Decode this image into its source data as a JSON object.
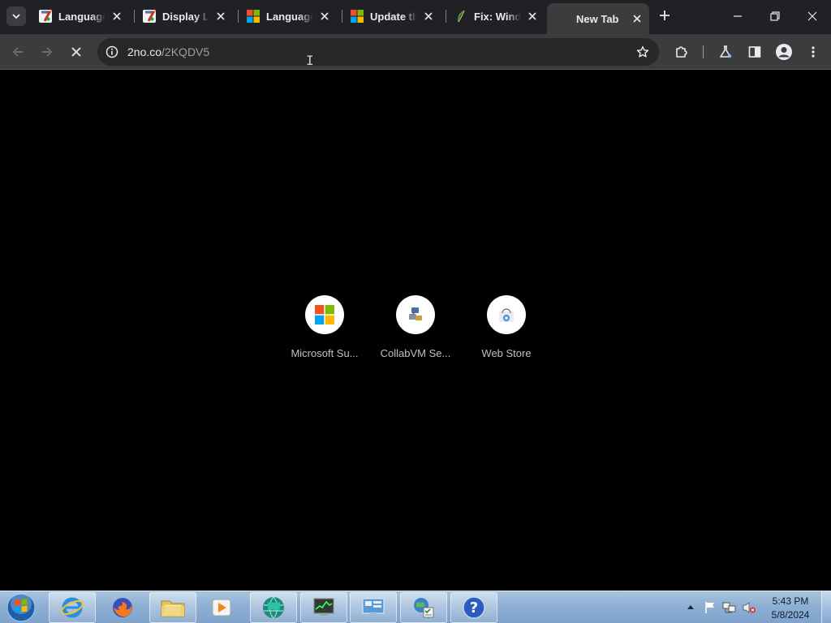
{
  "browser": {
    "tabs": [
      {
        "title": "Language",
        "icon": "seven-forums-icon"
      },
      {
        "title": "Display La",
        "icon": "seven-forums-icon"
      },
      {
        "title": "Language",
        "icon": "microsoft-logo-icon"
      },
      {
        "title": "Update th",
        "icon": "microsoft-logo-icon"
      },
      {
        "title": "Fix: Windo",
        "icon": "feather-icon"
      },
      {
        "title": "New Tab",
        "icon": "none",
        "active": true
      }
    ],
    "address": {
      "host": "2no.co",
      "path": "/2KQDV5"
    }
  },
  "shortcuts": [
    {
      "label": "Microsoft Su...",
      "icon": "microsoft-logo-icon"
    },
    {
      "label": "CollabVM Se...",
      "icon": "collabvm-icon"
    },
    {
      "label": "Web Store",
      "icon": "web-store-icon"
    }
  ],
  "taskbar": {
    "apps": [
      "internet-explorer",
      "firefox",
      "windows-explorer",
      "media-player",
      "browser-globe",
      "task-manager",
      "control-panel",
      "network-globe",
      "help-and-support"
    ],
    "clock": {
      "time": "5:43 PM",
      "date": "5/8/2024"
    }
  },
  "colors": {
    "tab_strip": "#202124",
    "toolbar": "#3c3c3e",
    "omnibox": "#282828",
    "page_background": "#000000"
  }
}
